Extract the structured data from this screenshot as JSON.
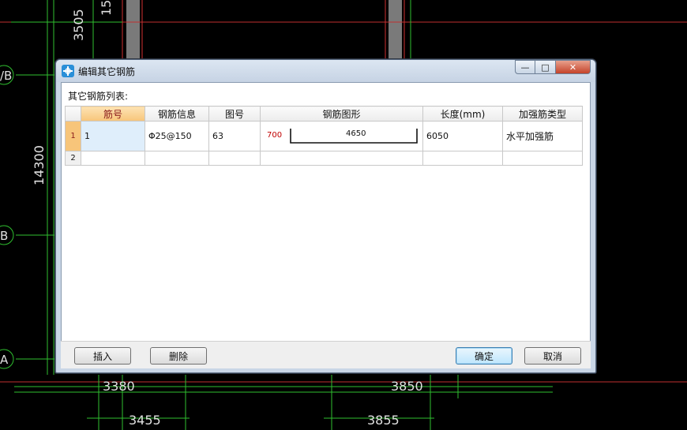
{
  "cad": {
    "dims": [
      "3505",
      "15",
      "14300",
      "3380",
      "3455",
      "3850",
      "3855"
    ],
    "axes": [
      "/B",
      "B",
      "A"
    ]
  },
  "dialog": {
    "title": "编辑其它钢筋",
    "close_glyph": "✕",
    "min_glyph": "—",
    "max_glyph": "□",
    "group_label": "其它钢筋列表:",
    "columns": [
      "筋号",
      "钢筋信息",
      "图号",
      "钢筋图形",
      "长度(mm)",
      "加强筋类型"
    ],
    "rows": [
      {
        "index": "1",
        "bar_no": "1",
        "bar_info": "Φ25@150",
        "shape_no": "63",
        "shape_left": "700",
        "shape_mid": "4650",
        "length": "6050",
        "type": "水平加强筋"
      },
      {
        "index": "2",
        "bar_no": "",
        "bar_info": "",
        "shape_no": "",
        "shape_left": "",
        "shape_mid": "",
        "length": "",
        "type": ""
      }
    ],
    "buttons": {
      "insert": "插入",
      "delete": "删除",
      "ok": "确定",
      "cancel": "取消"
    }
  },
  "colors": {
    "selected_header": "#f7c57a",
    "dim_red": "#c00000"
  }
}
